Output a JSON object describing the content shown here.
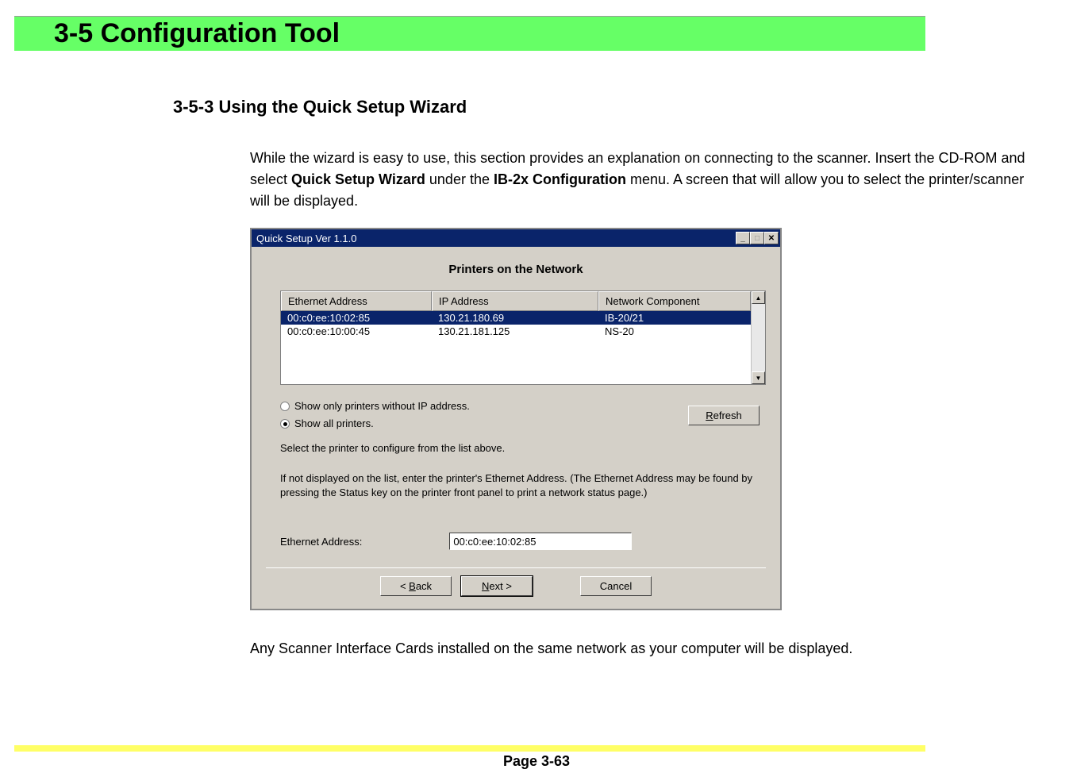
{
  "banner": {
    "title": "3-5  Configuration Tool"
  },
  "section": {
    "title": "3-5-3   Using the Quick Setup Wizard"
  },
  "intro": {
    "pre": "While the wizard is easy to use, this section provides an explanation on connecting to the scanner. Insert the CD-ROM and select ",
    "bold1": "Quick Setup Wizard",
    "mid": " under the ",
    "bold2": "IB-2x Configuration",
    "post": " menu. A screen that will allow you to select the printer/scanner will be displayed."
  },
  "dialog": {
    "title": "Quick Setup Ver 1.1.0",
    "heading": "Printers on the Network",
    "columns": {
      "c1": "Ethernet Address",
      "c2": "IP Address",
      "c3": "Network Component"
    },
    "rows": [
      {
        "eth": "00:c0:ee:10:02:85",
        "ip": "130.21.180.69",
        "comp": "IB-20/21",
        "selected": true
      },
      {
        "eth": "00:c0:ee:10:00:45",
        "ip": "130.21.181.125",
        "comp": "NS-20",
        "selected": false
      }
    ],
    "radios": {
      "opt1": "Show only printers without IP address.",
      "opt2": "Show all printers."
    },
    "refresh": "Refresh",
    "refresh_u": "R",
    "select_text": "Select the printer to configure from the list above.",
    "help_text": "If not displayed on the list, enter the printer's Ethernet Address. (The Ethernet Address may be found by pressing the Status key on the printer front panel to print a network status page.)",
    "eth_label": "Ethernet Address:",
    "eth_value": "00:c0:ee:10:02:85",
    "buttons": {
      "back": "< Back",
      "back_u": "B",
      "next": "Next >",
      "next_u": "N",
      "cancel": "Cancel"
    }
  },
  "outro": "Any Scanner Interface Cards installed on the same network as your computer will be displayed.",
  "page": "Page 3-63"
}
